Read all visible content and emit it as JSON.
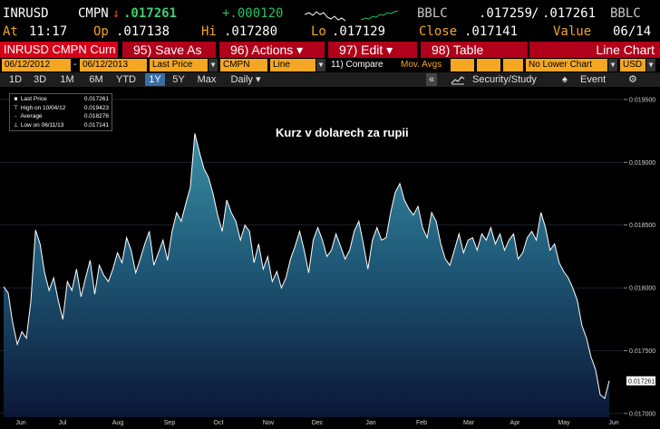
{
  "header": {
    "ticker": "INRUSD",
    "source": "CMPN",
    "arrow": "↓",
    "last": ".017261",
    "change": "+.000120",
    "bid_source": "BBLC",
    "bid": ".017259",
    "ask": ".017261",
    "ask_source": "BBLC",
    "at_label": "At",
    "time": "11:17",
    "open_label": "Op",
    "open": ".017138",
    "high_label": "Hi",
    "high": ".017280",
    "low_label": "Lo",
    "low": ".017129",
    "close_label": "Close",
    "close": ".017141",
    "value_label": "Value",
    "value_date": "06/14"
  },
  "toolbar": {
    "ticker_field": "INRUSD CMPN Curn",
    "save_as": "95) Save As",
    "actions": "96) Actions ▾",
    "edit": "97) Edit ▾",
    "table": "98) Table",
    "chart_type": "Line Chart"
  },
  "controls": {
    "start_date": "06/12/2012",
    "end_date": "06/12/2013",
    "field": "Last Price",
    "source": "CMPN",
    "style": "Line",
    "compare": "11) Compare",
    "mov_avgs": "Mov. Avgs",
    "lower_chart": "No Lower Chart",
    "currency": "USD"
  },
  "periods": {
    "items": [
      "1D",
      "3D",
      "1M",
      "6M",
      "YTD",
      "1Y",
      "5Y",
      "Max"
    ],
    "active": "1Y",
    "frequency": "Daily ▾",
    "security_study": "Security/Study",
    "event": "Event",
    "collapse": "«"
  },
  "legend": {
    "last_label": "Last Price",
    "last_value": "0.017261",
    "high_label": "High on 10/04/12",
    "high_value": "0.019423",
    "avg_label": "Average",
    "avg_value": "0.018276",
    "low_label": "Low on 06/11/13",
    "low_value": "0.017141"
  },
  "annotation": "Kurz v dolarech za rupii",
  "colors": {
    "orange": "#f5a623",
    "red": "#b0001a",
    "green": "#22c55e",
    "line": "#ffffff"
  },
  "chart_data": {
    "type": "area",
    "title": "",
    "x_labels": [
      "Jun",
      "Jul",
      "Aug",
      "Sep",
      "Oct",
      "Nov",
      "Dec",
      "Jan",
      "Feb",
      "Mar",
      "Apr",
      "May",
      "Jun"
    ],
    "y_ticks": [
      "0.019500",
      "0.019000",
      "0.018500",
      "0.018000",
      "0.017500",
      "0.017000"
    ],
    "ylim": [
      0.01697,
      0.01955
    ],
    "last_value_tag": "0.017261",
    "grid": true,
    "series": [
      {
        "values": [
          0.01801,
          0.01796,
          0.01772,
          0.01755,
          0.01765,
          0.0176,
          0.0179,
          0.01846,
          0.01835,
          0.01812,
          0.01798,
          0.01808,
          0.0179,
          0.01775,
          0.01805,
          0.01798,
          0.01815,
          0.01793,
          0.01808,
          0.01822,
          0.01795,
          0.01818,
          0.0181,
          0.01805,
          0.01815,
          0.01828,
          0.0182,
          0.0184,
          0.0183,
          0.01812,
          0.01823,
          0.01835,
          0.01845,
          0.01818,
          0.01828,
          0.01838,
          0.01822,
          0.01845,
          0.0186,
          0.01853,
          0.01867,
          0.0188,
          0.01923,
          0.01908,
          0.01895,
          0.01888,
          0.01875,
          0.01858,
          0.01845,
          0.0187,
          0.0186,
          0.01853,
          0.01838,
          0.0185,
          0.01845,
          0.0182,
          0.01835,
          0.01815,
          0.01825,
          0.01805,
          0.01813,
          0.018,
          0.01808,
          0.01823,
          0.01833,
          0.01845,
          0.0183,
          0.01812,
          0.01838,
          0.01848,
          0.01838,
          0.01825,
          0.0183,
          0.01843,
          0.01833,
          0.01823,
          0.0183,
          0.01845,
          0.01853,
          0.01835,
          0.01815,
          0.01838,
          0.01848,
          0.01838,
          0.0184,
          0.0186,
          0.01876,
          0.01883,
          0.0187,
          0.01863,
          0.01858,
          0.01865,
          0.01848,
          0.0184,
          0.0186,
          0.01853,
          0.01835,
          0.01823,
          0.01818,
          0.0183,
          0.01843,
          0.01828,
          0.01838,
          0.0184,
          0.0183,
          0.01843,
          0.01838,
          0.01848,
          0.01835,
          0.01843,
          0.0183,
          0.01838,
          0.01843,
          0.01823,
          0.01828,
          0.0184,
          0.01845,
          0.01838,
          0.0186,
          0.01848,
          0.0183,
          0.01835,
          0.0182,
          0.01813,
          0.01808,
          0.018,
          0.0179,
          0.0177,
          0.0176,
          0.01745,
          0.01735,
          0.01715,
          0.01712,
          0.01726
        ]
      }
    ]
  }
}
